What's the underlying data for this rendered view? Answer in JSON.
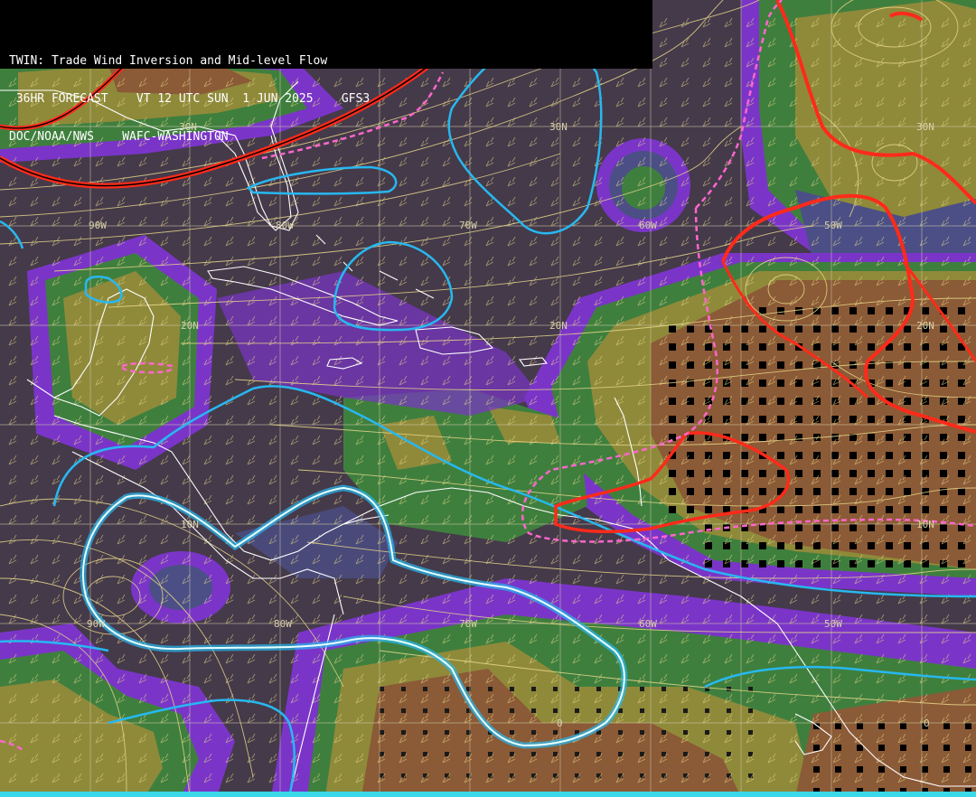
{
  "header": {
    "line1": "TWIN: Trade Wind Inversion and Mid-level Flow",
    "line2": " 36HR FORECAST    VT 12 UTC SUN  1 JUN 2025    GFS3",
    "line3": "DOC/NOAA/NWS    WAFC-WASHINGTON"
  },
  "grid_labels": {
    "lat_30n": "30N",
    "lat_20n": "20N",
    "lat_10n": "10N",
    "lat_0": "0",
    "lon_90w": "90W",
    "lon_80w": "80W",
    "lon_70w": "70W",
    "lon_60w": "60W",
    "lon_50w": "50W"
  },
  "colors": {
    "background": "#453a4a",
    "purple": "#7a35c8",
    "slate": "#4b4f86",
    "green": "#3f7f3e",
    "lightgreen": "#5c8d3a",
    "olive": "#8f8a3a",
    "brown": "#8b5a36",
    "cyan_contour": "#27b8f0",
    "red_contour": "#ff2a1a",
    "pink_dashed": "#ff66cc",
    "streamline": "#e8d88a",
    "coast": "#ffffff"
  }
}
